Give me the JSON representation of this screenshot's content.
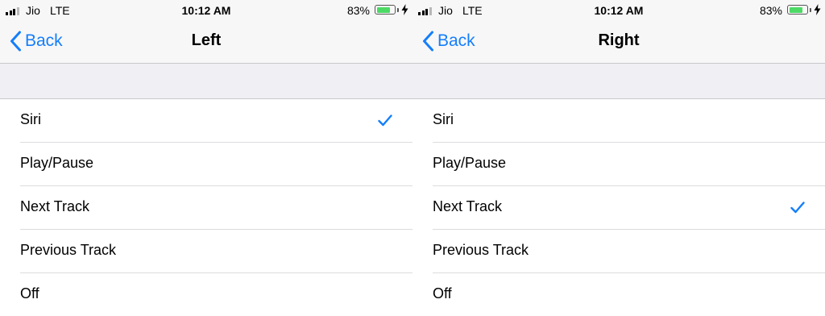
{
  "colors": {
    "accent": "#147efb",
    "battery": "#4cd964",
    "group_bg": "#efeff4"
  },
  "panels": [
    {
      "status": {
        "carrier": "Jio",
        "network": "LTE",
        "time": "10:12 AM",
        "battery_percent": "83%",
        "battery_level": 0.83
      },
      "nav": {
        "back_label": "Back",
        "title": "Left"
      },
      "options": [
        "Siri",
        "Play/Pause",
        "Next Track",
        "Previous Track",
        "Off"
      ],
      "selected": "Siri"
    },
    {
      "status": {
        "carrier": "Jio",
        "network": "LTE",
        "time": "10:12 AM",
        "battery_percent": "83%",
        "battery_level": 0.83
      },
      "nav": {
        "back_label": "Back",
        "title": "Right"
      },
      "options": [
        "Siri",
        "Play/Pause",
        "Next Track",
        "Previous Track",
        "Off"
      ],
      "selected": "Next Track"
    }
  ]
}
